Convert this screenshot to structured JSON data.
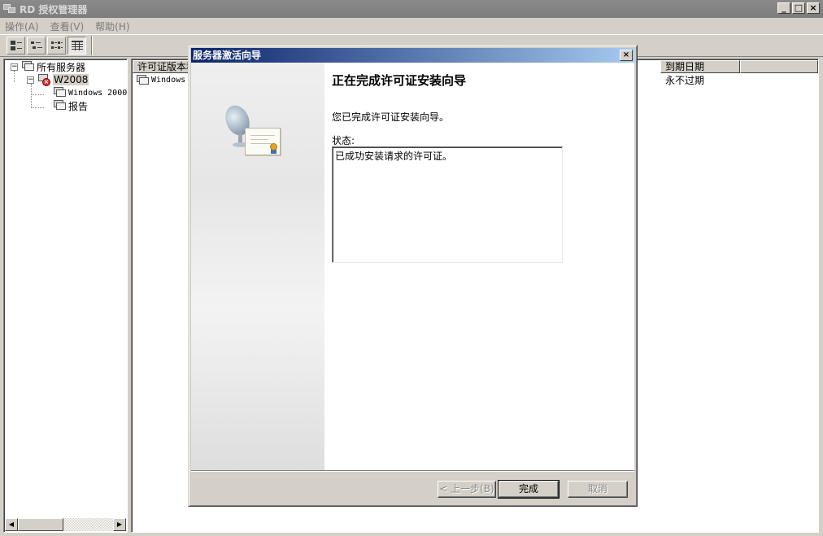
{
  "window": {
    "title": "RD 授权管理器",
    "controls": {
      "minimize": "_",
      "maximize": "□",
      "close": "×"
    }
  },
  "menu": [
    "操作(A)",
    "查看(V)",
    "帮助(H)"
  ],
  "toolbar": {
    "buttons": [
      "large-icons-view",
      "small-icons-view",
      "list-view",
      "details-view"
    ],
    "pressed": "details-view"
  },
  "tree": {
    "root": {
      "label": "所有服务器",
      "expander": "−"
    },
    "server": {
      "label": "W2008",
      "expander": "−",
      "status": "error"
    },
    "children": [
      "Windows 2000",
      "报告"
    ]
  },
  "list": {
    "columns": [
      "许可证版本和类型",
      "到期日期"
    ],
    "rows": [
      {
        "name": "Windows",
        "expiry": "永不过期"
      }
    ]
  },
  "dialog": {
    "title": "服务器激活向导",
    "close": "×",
    "heading": "正在完成许可证安装向导",
    "message": "您已完成许可证安装向导。",
    "status_label": "状态:",
    "status_text": "已成功安装请求的许可证。",
    "buttons": {
      "back": "< 上一步(B)",
      "finish": "完成",
      "cancel": "取消"
    }
  },
  "colors": {
    "dialog_title_start": "#0a246a",
    "dialog_title_end": "#a6caf0",
    "inactive_title": "#808080",
    "error_badge": "#d62b2b"
  }
}
